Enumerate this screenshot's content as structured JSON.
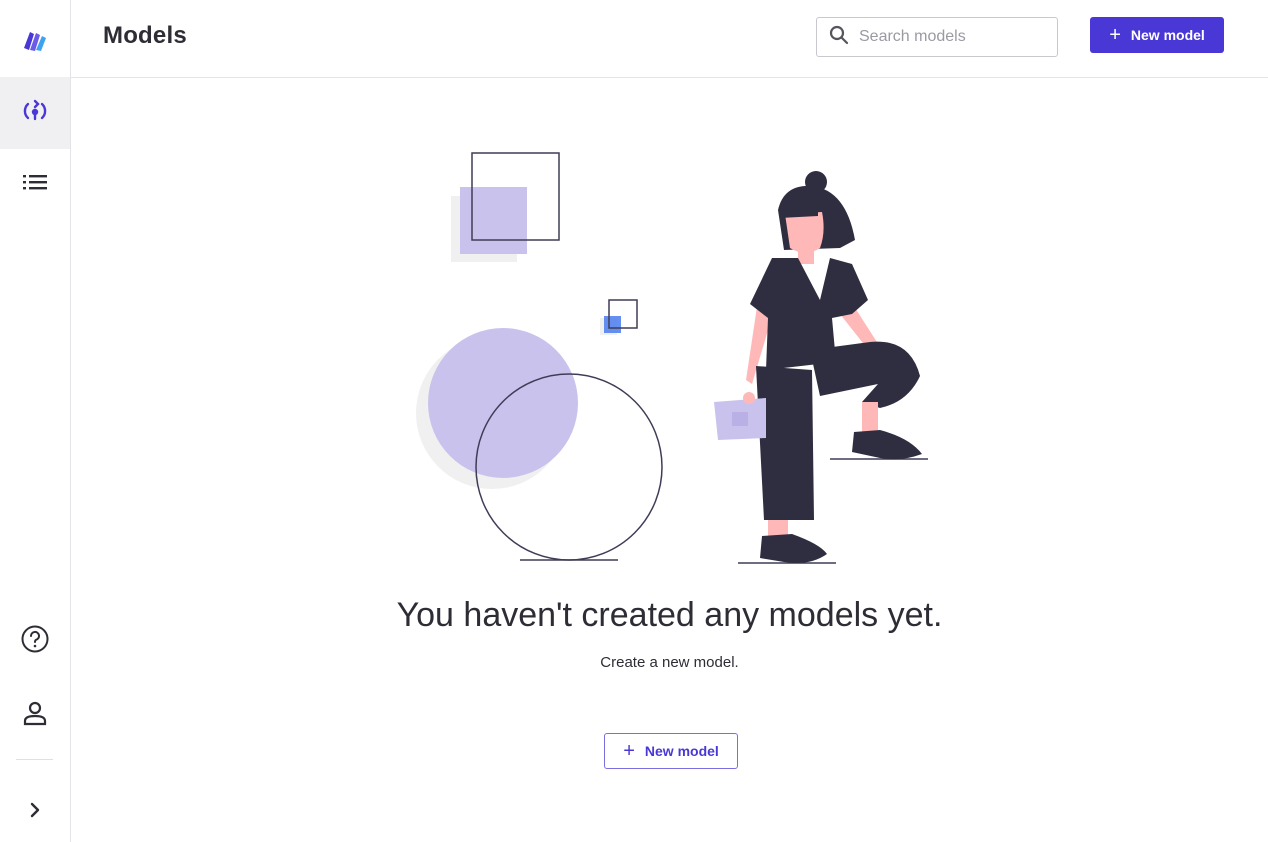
{
  "header": {
    "title": "Models",
    "search_placeholder": "Search models",
    "new_model_label": "New model"
  },
  "sidebar": {
    "items": [
      {
        "icon": "app-logo-icon",
        "active": false
      },
      {
        "icon": "model-deploy-icon",
        "active": true
      },
      {
        "icon": "list-icon",
        "active": false
      },
      {
        "icon": "help-icon",
        "active": false
      },
      {
        "icon": "user-icon",
        "active": false
      },
      {
        "icon": "chevron-right-icon",
        "active": false
      }
    ]
  },
  "empty_state": {
    "title": "You haven't created any models yet.",
    "subtitle": "Create a new model.",
    "button_label": "New model"
  },
  "colors": {
    "accent": "#4a38d6",
    "illustration_purple": "#c9c2ec",
    "illustration_dark": "#2f2e41",
    "skin": "#ffb8b8"
  }
}
